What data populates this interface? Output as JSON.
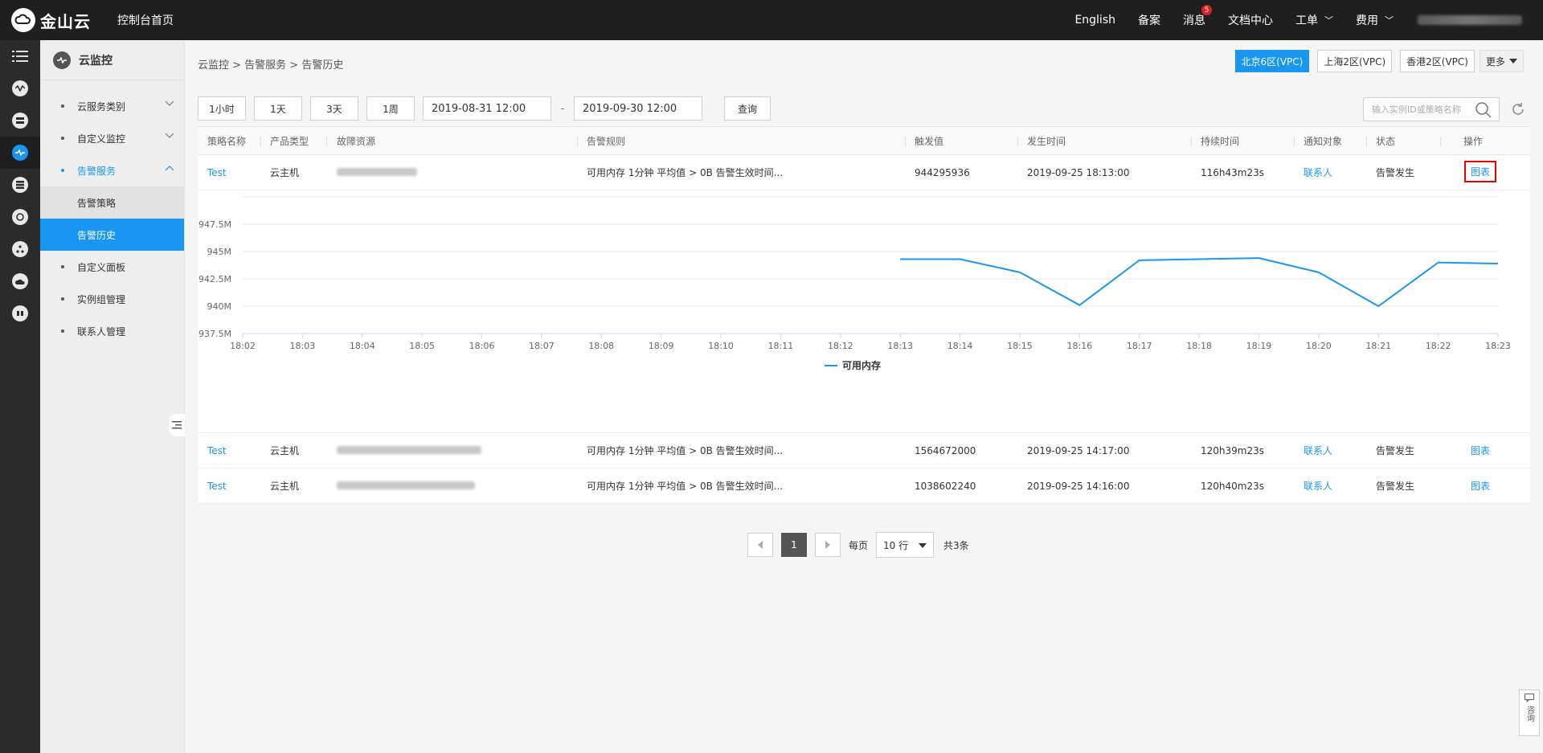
{
  "topbar": {
    "brand": "金山云",
    "console_home": "控制台首页",
    "nav": [
      {
        "label": "English"
      },
      {
        "label": "备案"
      },
      {
        "label": "消息",
        "badge": "5"
      },
      {
        "label": "文档中心"
      },
      {
        "label": "工单"
      },
      {
        "label": "费用"
      }
    ]
  },
  "sidebar": {
    "title": "云监控",
    "items": [
      {
        "label": "云服务类别"
      },
      {
        "label": "自定义监控"
      },
      {
        "label": "告警服务"
      },
      {
        "label": "告警策略"
      },
      {
        "label": "告警历史"
      },
      {
        "label": "自定义面板"
      },
      {
        "label": "实例组管理"
      },
      {
        "label": "联系人管理"
      }
    ]
  },
  "breadcrumb": "云监控 > 告警服务 > 告警历史",
  "regions": [
    "北京6区(VPC)",
    "上海2区(VPC)",
    "香港2区(VPC)",
    "更多"
  ],
  "toolbar": {
    "ranges": [
      "1小时",
      "1天",
      "3天",
      "1周"
    ],
    "start": "2019-08-31 12:00",
    "dash": "-",
    "end": "2019-09-30 12:00",
    "query": "查询",
    "search_placeholder": "输入实例ID或策略名称"
  },
  "table": {
    "headers": [
      "策略名称",
      "产品类型",
      "故障资源",
      "告警规则",
      "触发值",
      "发生时间",
      "持续时间",
      "通知对象",
      "状态",
      "操作"
    ],
    "rows": [
      {
        "name": "Test",
        "product": "云主机",
        "rule": "可用内存 1分钟 平均值 > 0B 告警生效时间...",
        "value": "944295936",
        "time": "2019-09-25 18:13:00",
        "duration": "116h43m23s",
        "notify": "联系人",
        "status": "告警发生",
        "action": "图表"
      },
      {
        "name": "Test",
        "product": "云主机",
        "rule": "可用内存 1分钟 平均值 > 0B 告警生效时间...",
        "value": "1564672000",
        "time": "2019-09-25 14:17:00",
        "duration": "120h39m23s",
        "notify": "联系人",
        "status": "告警发生",
        "action": "图表"
      },
      {
        "name": "Test",
        "product": "云主机",
        "rule": "可用内存 1分钟 平均值 > 0B 告警生效时间...",
        "value": "1038602240",
        "time": "2019-09-25 14:16:00",
        "duration": "120h40m23s",
        "notify": "联系人",
        "status": "告警发生",
        "action": "图表"
      }
    ]
  },
  "chart_data": {
    "type": "line",
    "x": [
      "18:02",
      "18:03",
      "18:04",
      "18:05",
      "18:06",
      "18:07",
      "18:08",
      "18:09",
      "18:10",
      "18:11",
      "18:12",
      "18:13",
      "18:14",
      "18:15",
      "18:16",
      "18:17",
      "18:18",
      "18:19",
      "18:20",
      "18:21",
      "18:22",
      "18:23"
    ],
    "y_ticks": [
      "937.5M",
      "940M",
      "942.5M",
      "945M",
      "947.5M"
    ],
    "ylim": [
      937.5,
      950
    ],
    "series": [
      {
        "name": "可用内存",
        "color": "#1996f2",
        "values": [
          null,
          null,
          null,
          null,
          null,
          null,
          null,
          null,
          null,
          null,
          null,
          944.3,
          944.3,
          943.1,
          940.1,
          944.2,
          944.3,
          944.4,
          943.1,
          940.0,
          944.0,
          943.9
        ]
      }
    ]
  },
  "pager": {
    "current": "1",
    "per_page_label": "每页",
    "per_page": "10 行",
    "total": "共3条"
  },
  "consult": "咨询"
}
